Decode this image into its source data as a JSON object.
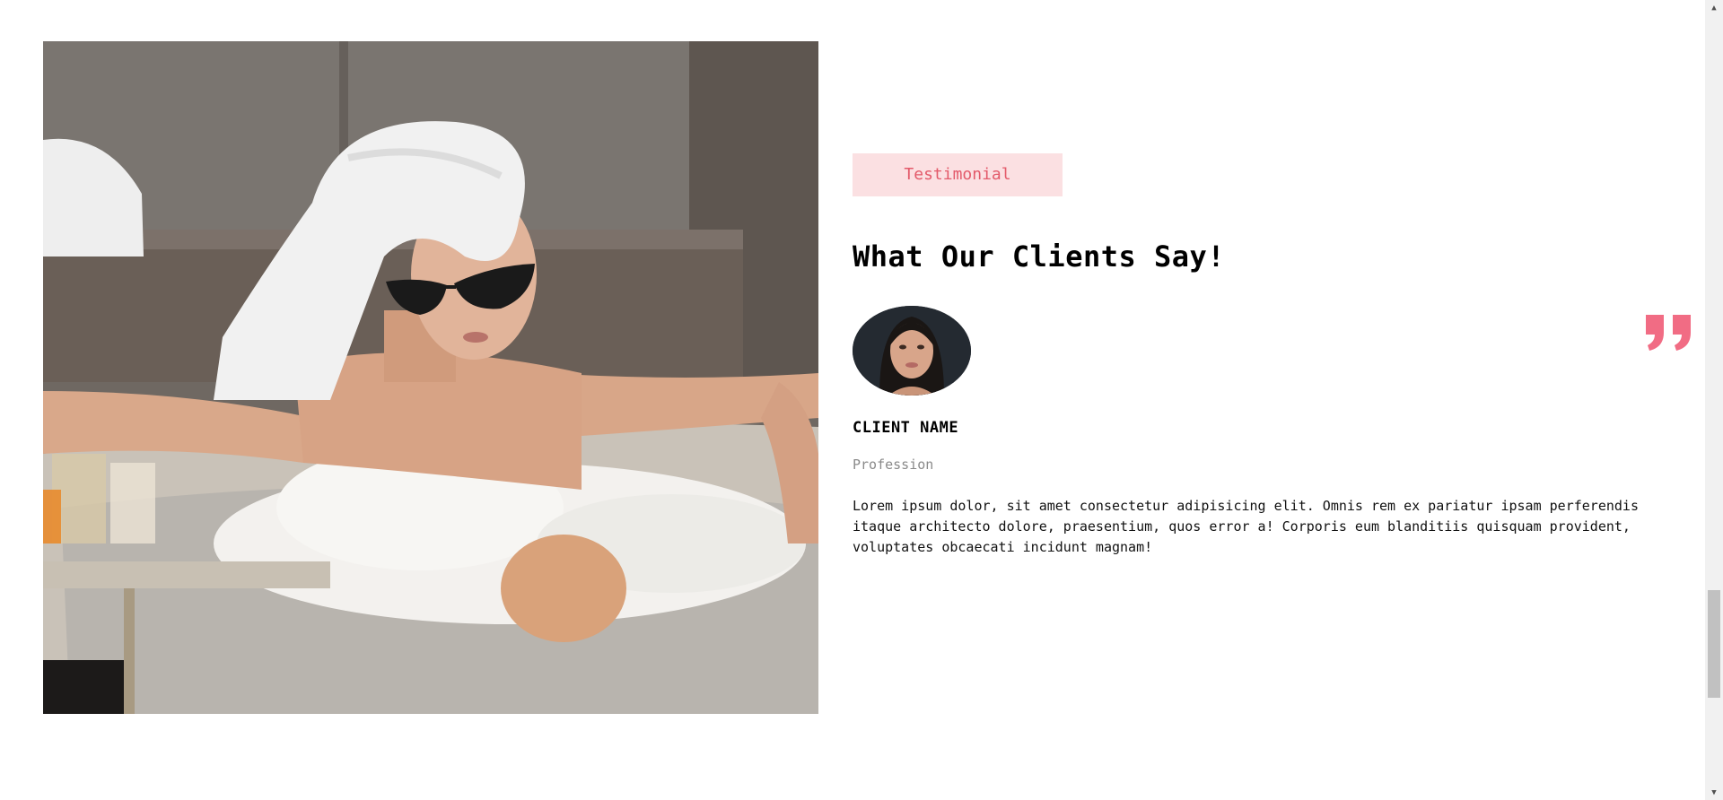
{
  "testimonial": {
    "tag_label": "Testimonial",
    "heading": "What Our Clients Say!",
    "client_name": "CLIENT NAME",
    "profession": "Profession",
    "quote": "Lorem ipsum dolor, sit amet consectetur adipisicing elit. Omnis rem ex pariatur ipsam perferendis itaque architecto dolore, praesentium, quos error a! Corporis eum blanditiis quisquam provident, voluptates obcaecati incidunt magnam!",
    "quote_icon": "quote-icon",
    "accent_color": "#f16c84",
    "tag_bg_color": "#fbe0e2"
  },
  "hero": {
    "image": "woman-in-bathtub-photo"
  },
  "scrollbar": {
    "up_icon": "up-arrow-icon",
    "down_icon": "down-arrow-icon"
  }
}
